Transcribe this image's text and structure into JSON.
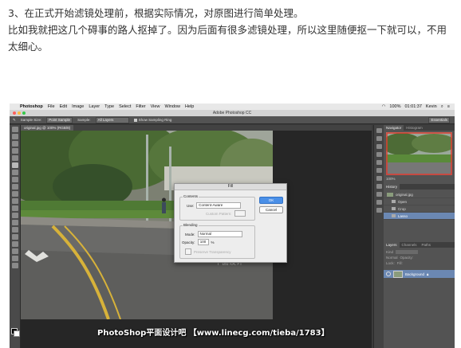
{
  "article": {
    "line1": "3、在正式开始滤镜处理前，根据实际情况，对原图进行简单处理。",
    "line2": "比如我就把这几个碍事的路人抠掉了。因为后面有很多滤镜处理，所以这里随便抠一下就可以，不用太细心。"
  },
  "macos_menubar": {
    "app": "Photoshop",
    "menus": [
      "File",
      "Edit",
      "Image",
      "Layer",
      "Type",
      "Select",
      "Filter",
      "View",
      "Window",
      "Help"
    ],
    "battery": "100%",
    "time": "01:01:37",
    "user": "Kevin"
  },
  "window_title": "Adobe Photoshop CC",
  "options_bar": {
    "sample_size_label": "Sample Size:",
    "sample_size_value": "Point Sample",
    "sample_label": "Sample:",
    "sample_value": "All Layers",
    "show_sampling_ring": "Show Sampling Ring",
    "workspace": "Essentials"
  },
  "document_tab": "original.jpg @ 100% (RGB/8)",
  "fill_dialog": {
    "title": "Fill",
    "contents_legend": "Contents",
    "use_label": "Use:",
    "use_value": "Content-Aware",
    "custom_pattern_label": "Custom Pattern:",
    "blending_legend": "Blending",
    "mode_label": "Mode:",
    "mode_value": "Normal",
    "opacity_label": "Opacity:",
    "opacity_value": "100",
    "opacity_unit": "%",
    "preserve_transparency": "Preserve Transparency",
    "ok": "OK",
    "cancel": "Cancel"
  },
  "panels": {
    "navigator_tabs": [
      "Navigator",
      "Histogram"
    ],
    "zoom": "100%",
    "history_tab": "History",
    "history_snapshot": "original.jpg",
    "history_items": [
      "Open",
      "Crop",
      "Lasso"
    ],
    "layers_tabs": [
      "Layers",
      "Channels",
      "Paths"
    ],
    "layers_kind": "Kind",
    "layers_blend": "Normal",
    "layers_opacity_label": "Opacity:",
    "layers_lock_label": "Lock:",
    "layers_fill_label": "Fill:",
    "layer_name": "Background"
  },
  "watermark": "PhotoShop平面设计吧 【www.linecg.com/tieba/1783】",
  "center_watermark": "平面设计",
  "colors": {
    "dialog_default_button": "#4a8fe7",
    "selection_blue": "#6b88b3",
    "ps_chrome": "#535353"
  }
}
